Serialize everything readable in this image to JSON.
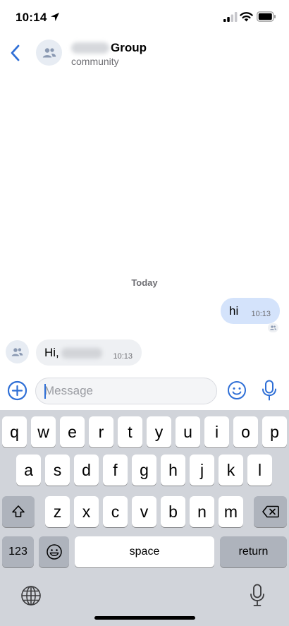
{
  "status_bar": {
    "time": "10:14"
  },
  "header": {
    "title": "Group",
    "subtitle": "community"
  },
  "chat": {
    "date_separator": "Today",
    "messages": [
      {
        "direction": "outgoing",
        "text": "hi",
        "time": "10:13"
      },
      {
        "direction": "incoming",
        "text": "Hi,",
        "time": "10:13"
      }
    ]
  },
  "composer": {
    "placeholder": "Message"
  },
  "keyboard": {
    "row1": [
      "q",
      "w",
      "e",
      "r",
      "t",
      "y",
      "u",
      "i",
      "o",
      "p"
    ],
    "row2": [
      "a",
      "s",
      "d",
      "f",
      "g",
      "h",
      "j",
      "k",
      "l"
    ],
    "row3": [
      "z",
      "x",
      "c",
      "v",
      "b",
      "n",
      "m"
    ],
    "numbers_label": "123",
    "space_label": "space",
    "return_label": "return"
  },
  "colors": {
    "accent": "#2f6fd6",
    "outgoing_bubble": "#d4e3fb",
    "incoming_bubble": "#eef0f3",
    "keyboard_bg": "#d1d4da"
  }
}
